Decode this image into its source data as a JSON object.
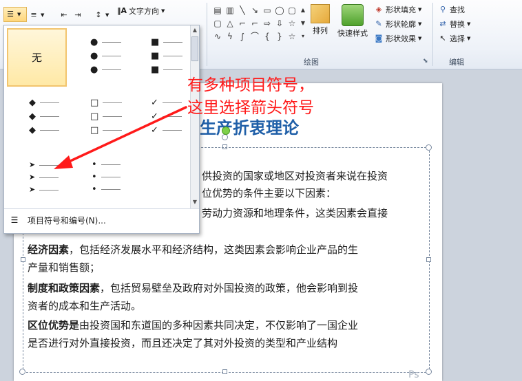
{
  "ribbon": {
    "paragraph": {
      "text_direction_label": "文字方向"
    },
    "shapes_group": {
      "label": "绘图",
      "arrange_label": "排列",
      "quick_style_label": "快速样式",
      "shape_fill_label": "形状填充",
      "shape_outline_label": "形状轮廓",
      "shape_effects_label": "形状效果"
    },
    "editing_group": {
      "label": "编辑",
      "find_label": "查找",
      "replace_label": "替换",
      "select_label": "选择"
    }
  },
  "bullets_dropdown": {
    "none_label": "无",
    "footer_label": "项目符号和编号(N)...",
    "styles": [
      {
        "name": "none",
        "glyph": ""
      },
      {
        "name": "filled-round",
        "glyph": "●"
      },
      {
        "name": "filled-square",
        "glyph": "■"
      },
      {
        "name": "diamond",
        "glyph": "◆"
      },
      {
        "name": "hollow-square",
        "glyph": "□"
      },
      {
        "name": "checkmark",
        "glyph": "✓"
      },
      {
        "name": "arrow",
        "glyph": "➤"
      },
      {
        "name": "small-dot",
        "glyph": "•"
      }
    ]
  },
  "annotation": {
    "line1": "有多种项目符号，",
    "line2": "这里选择箭头符号",
    "color": "#ff1a1a"
  },
  "slide": {
    "title": "生产折衷理论",
    "lines": [
      {
        "bold": "",
        "text": "供投资的国家或地区对投资者来说在投资"
      },
      {
        "bold": "",
        "text": "位优势的条件主要以下因素："
      },
      {
        "bold": "",
        "text": "劳动力资源和地理条件，这类因素会直接"
      },
      {
        "bold": "经济因素",
        "text": "，包括经济发展水平和经济结构，这类因素会影响企业产品的生"
      },
      {
        "bold": "",
        "text": "产量和销售额；"
      },
      {
        "bold": "制度和政策因素",
        "text": "，包括贸易壁垒及政府对外国投资的政策，他会影响到投"
      },
      {
        "bold": "",
        "text": "资者的成本和生产活动。"
      },
      {
        "bold": "区位优势是",
        "text": "由投资国和东道国的多种因素共同决定，不仅影响了一国企业"
      },
      {
        "bold": "",
        "text": "是否进行对外直接投资，而且还决定了其对外投资的类型和产业结构"
      }
    ]
  },
  "colors": {
    "title": "#1f5fa8",
    "selection": "#f2c46d",
    "ribbon": "#eef2f8"
  }
}
